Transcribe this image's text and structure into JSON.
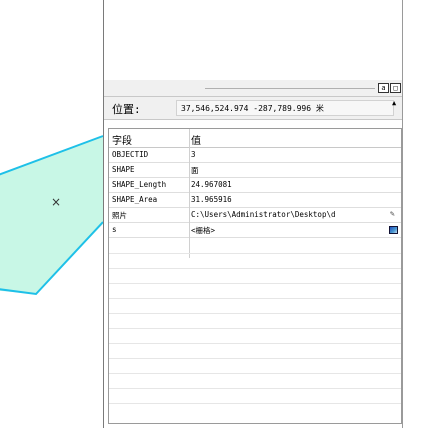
{
  "map": {
    "polygon_fill": "#c8f7e6",
    "polygon_stroke": "#1ec0e8",
    "cursor_glyph": "×"
  },
  "identify": {
    "dock_buttons": [
      "a",
      "□"
    ],
    "location": {
      "label": "位置:",
      "value": "37,546,524.974  -287,789.996 米"
    },
    "table": {
      "header": {
        "field": "字段",
        "value": "值"
      },
      "rows": [
        {
          "field": "OBJECTID",
          "value": "3"
        },
        {
          "field": "SHAPE",
          "value": "面"
        },
        {
          "field": "SHAPE_Length",
          "value": "24.967081"
        },
        {
          "field": "SHAPE_Area",
          "value": "31.965916"
        },
        {
          "field": "照片",
          "value": "C:\\Users\\Administrator\\Desktop\\d"
        },
        {
          "field": "s",
          "value": "<栅格>"
        }
      ]
    }
  }
}
